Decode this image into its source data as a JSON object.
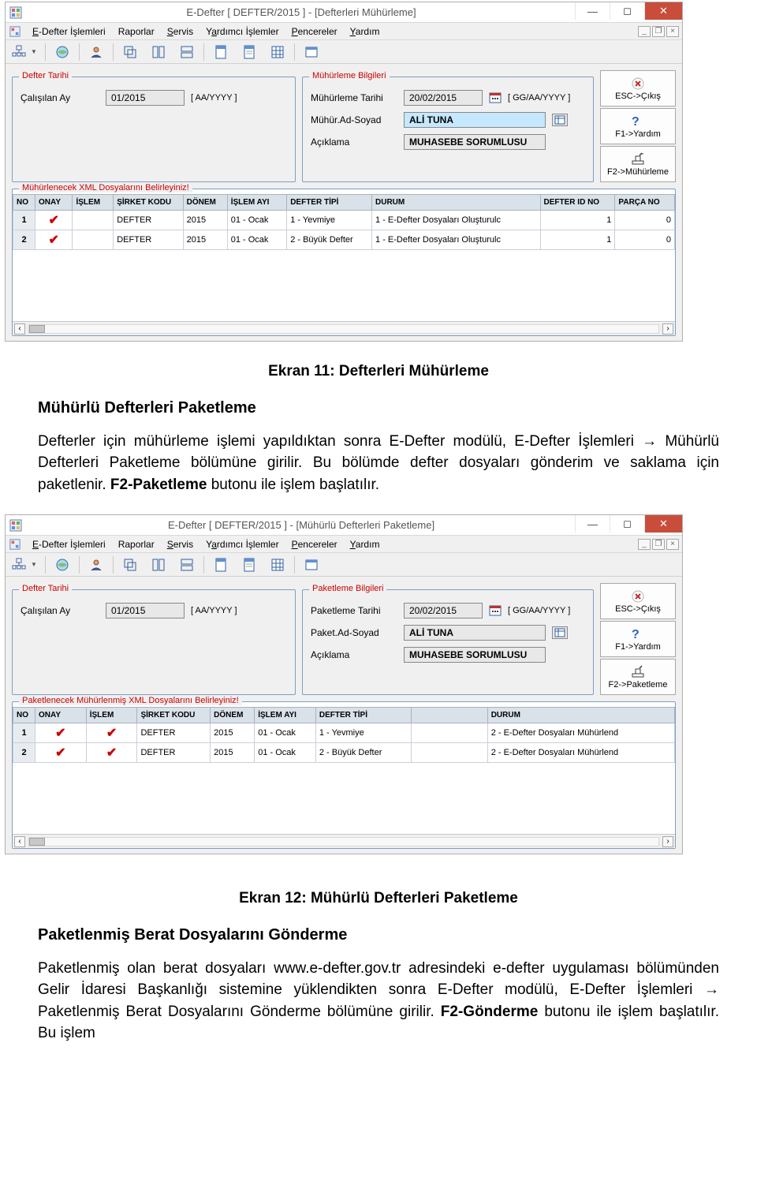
{
  "window1": {
    "title": "E-Defter [ DEFTER/2015 ]  -  [Defterleri Mühürleme]",
    "menu": [
      "E-Defter İşlemleri",
      "Raporlar",
      "Servis",
      "Yardımcı İşlemler",
      "Pencereler",
      "Yardım"
    ],
    "fs_defter": {
      "legend": "Defter Tarihi",
      "r1_label": "Çalışılan Ay",
      "r1_value": "01/2015",
      "r1_hint": "[ AA/YYYY ]"
    },
    "fs_info": {
      "legend": "Mühürleme Bilgileri",
      "r1_label": "Mühürleme Tarihi",
      "r1_value": "20/02/2015",
      "r1_hint": "[ GG/AA/YYYY ]",
      "r2_label": "Mühür.Ad-Soyad",
      "r2_value": "ALİ TUNA",
      "r3_label": "Açıklama",
      "r3_value": "MUHASEBE SORUMLUSU"
    },
    "side": [
      {
        "icon": "close",
        "label": "ESC->Çıkış"
      },
      {
        "icon": "help",
        "label": "F1->Yardım"
      },
      {
        "icon": "action",
        "label": "F2->Mühürleme"
      }
    ],
    "grid": {
      "legend": "Mühürlenecek XML Dosyalarını Belirleyiniz!",
      "headers": [
        "NO",
        "ONAY",
        "İŞLEM",
        "ŞİRKET KODU",
        "DÖNEM",
        "İŞLEM AYI",
        "DEFTER TİPİ",
        "DURUM",
        "DEFTER ID NO",
        "PARÇA NO"
      ],
      "rows": [
        [
          "1",
          "✔",
          "",
          "DEFTER",
          "2015",
          "01 - Ocak",
          "1 - Yevmiye",
          "1 - E-Defter Dosyaları Oluşturulc",
          "1",
          "0"
        ],
        [
          "2",
          "✔",
          "",
          "DEFTER",
          "2015",
          "01 - Ocak",
          "2 - Büyük Defter",
          "1 - E-Defter Dosyaları Oluşturulc",
          "1",
          "0"
        ]
      ]
    }
  },
  "doc1": {
    "caption": "Ekran 11: Defterleri Mühürleme",
    "heading": "Mühürlü Defterleri Paketleme",
    "p1_a": "Defterler için mühürleme işlemi yapıldıktan sonra E-Defter modülü, E-Defter İşlemleri → Mühürlü Defterleri Paketleme bölümüne girilir. Bu bölümde defter dosyaları gönderim ve saklama için paketlenir. ",
    "p1_b": "F2-Paketleme",
    "p1_c": " butonu ile işlem başlatılır."
  },
  "window2": {
    "title": "E-Defter [ DEFTER/2015 ]  -  [Mühürlü Defterleri Paketleme]",
    "menu": [
      "E-Defter İşlemleri",
      "Raporlar",
      "Servis",
      "Yardımcı İşlemler",
      "Pencereler",
      "Yardım"
    ],
    "fs_defter": {
      "legend": "Defter Tarihi",
      "r1_label": "Çalışılan Ay",
      "r1_value": "01/2015",
      "r1_hint": "[ AA/YYYY ]"
    },
    "fs_info": {
      "legend": "Paketleme Bilgileri",
      "r1_label": "Paketleme Tarihi",
      "r1_value": "20/02/2015",
      "r1_hint": "[ GG/AA/YYYY ]",
      "r2_label": "Paket.Ad-Soyad",
      "r2_value": "ALİ TUNA",
      "r3_label": "Açıklama",
      "r3_value": "MUHASEBE SORUMLUSU"
    },
    "side": [
      {
        "icon": "close",
        "label": "ESC->Çıkış"
      },
      {
        "icon": "help",
        "label": "F1->Yardım"
      },
      {
        "icon": "action",
        "label": "F2->Paketleme"
      }
    ],
    "grid": {
      "legend": "Paketlenecek Mühürlenmiş XML Dosyalarını Belirleyiniz!",
      "headers": [
        "NO",
        "ONAY",
        "İŞLEM",
        "ŞİRKET KODU",
        "DÖNEM",
        "İŞLEM AYI",
        "DEFTER TİPİ",
        "",
        "DURUM"
      ],
      "rows": [
        [
          "1",
          "✔",
          "✔",
          "DEFTER",
          "2015",
          "01 - Ocak",
          "1 - Yevmiye",
          "",
          "2 - E-Defter Dosyaları Mühürlend"
        ],
        [
          "2",
          "✔",
          "✔",
          "DEFTER",
          "2015",
          "01 - Ocak",
          "2 - Büyük Defter",
          "",
          "2 - E-Defter Dosyaları Mühürlend"
        ]
      ]
    }
  },
  "doc2": {
    "caption": "Ekran 12: Mühürlü Defterleri Paketleme",
    "heading": "Paketlenmiş Berat Dosyalarını Gönderme",
    "p1_a": "Paketlenmiş olan berat dosyaları www.e-defter.gov.tr adresindeki e-defter uygulaması bölümünden Gelir İdaresi Başkanlığı sistemine yüklendikten sonra E-Defter modülü, E-Defter İşlemleri → Paketlenmiş Berat Dosyalarını Gönderme bölümüne girilir. ",
    "p1_b": "F2-Gönderme",
    "p1_c": " butonu ile işlem başlatılır. Bu işlem"
  }
}
